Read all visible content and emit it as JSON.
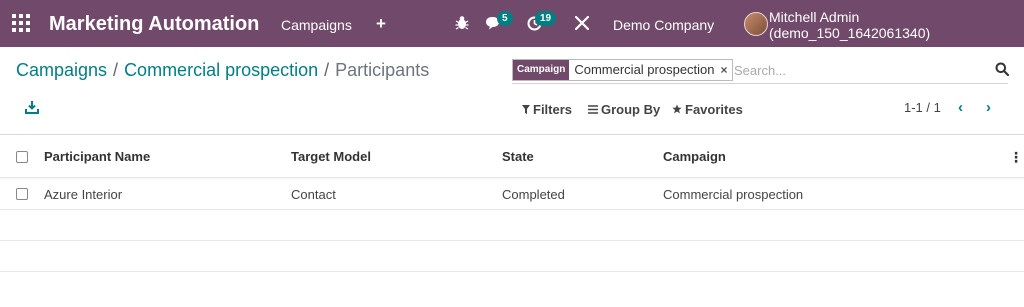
{
  "navbar": {
    "app_title": "Marketing Automation",
    "menu_campaigns": "Campaigns",
    "plus_icon": "+",
    "chat_badge": "5",
    "activity_badge": "19",
    "company": "Demo Company",
    "user": "Mitchell Admin (demo_150_1642061340)",
    "bg_color": "#71496a",
    "badge_color": "#017e84"
  },
  "breadcrumb": {
    "items": [
      "Campaigns",
      "Commercial prospection"
    ],
    "separator": "/",
    "current": "Participants"
  },
  "search": {
    "facet_label": "Campaign",
    "facet_value": "Commercial prospection",
    "facet_remove": "×",
    "placeholder": "Search..."
  },
  "toolbar": {
    "filters": "Filters",
    "group_by": "Group By",
    "favorites": "Favorites",
    "pager": "1-1 / 1",
    "prev": "‹",
    "next": "›"
  },
  "table": {
    "headers": [
      "Participant Name",
      "Target Model",
      "State",
      "Campaign"
    ],
    "options_icon": "⋮",
    "rows": [
      [
        "Azure Interior",
        "Contact",
        "Completed",
        "Commercial prospection"
      ]
    ]
  }
}
